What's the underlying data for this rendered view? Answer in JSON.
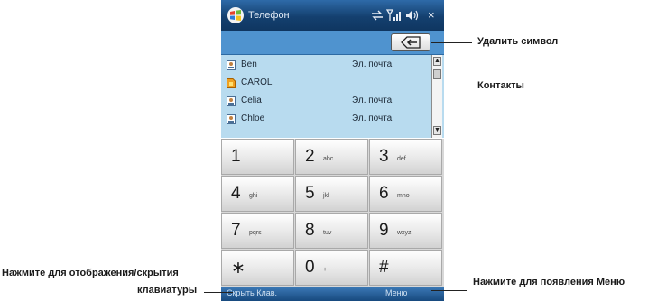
{
  "title_bar": {
    "title": "Телефон",
    "close_glyph": "×",
    "icons": [
      "windows-logo",
      "network-arrows-icon",
      "signal-strength-icon",
      "volume-icon"
    ]
  },
  "number_field": {
    "value": ""
  },
  "contacts": [
    {
      "name": "Ben",
      "type": "Эл. почта",
      "icon": "contact-card-icon"
    },
    {
      "name": "CAROL",
      "type": "",
      "icon": "sim-contact-icon"
    },
    {
      "name": "Celia",
      "type": "Эл. почта",
      "icon": "contact-card-icon"
    },
    {
      "name": "Chloe",
      "type": "Эл. почта",
      "icon": "contact-card-icon"
    }
  ],
  "keypad": [
    {
      "digit": "1",
      "letters": ""
    },
    {
      "digit": "2",
      "letters": "abc"
    },
    {
      "digit": "3",
      "letters": "def"
    },
    {
      "digit": "4",
      "letters": "ghi"
    },
    {
      "digit": "5",
      "letters": "jkl"
    },
    {
      "digit": "6",
      "letters": "mno"
    },
    {
      "digit": "7",
      "letters": "pqrs"
    },
    {
      "digit": "8",
      "letters": "tuv"
    },
    {
      "digit": "9",
      "letters": "wxyz"
    },
    {
      "digit": "∗",
      "letters": ""
    },
    {
      "digit": "0",
      "letters": "+"
    },
    {
      "digit": "#",
      "letters": ""
    }
  ],
  "softkeys": {
    "left": "Скрыть Клав.",
    "right": "Меню"
  },
  "callouts": {
    "delete": "Удалить символ",
    "contacts": "Контакты",
    "toggle_keypad_line1": "Нажмите для отображения/скрытия",
    "toggle_keypad_line2": "клавиатуры",
    "menu": "Нажмите для появления Меню"
  },
  "colors": {
    "title_bar": "#14406f",
    "number_field": "#4f93cf",
    "contacts_bg": "#b8dbef",
    "keypad_bg": "#d8d8d8",
    "softkey_bar": "#17497e"
  }
}
